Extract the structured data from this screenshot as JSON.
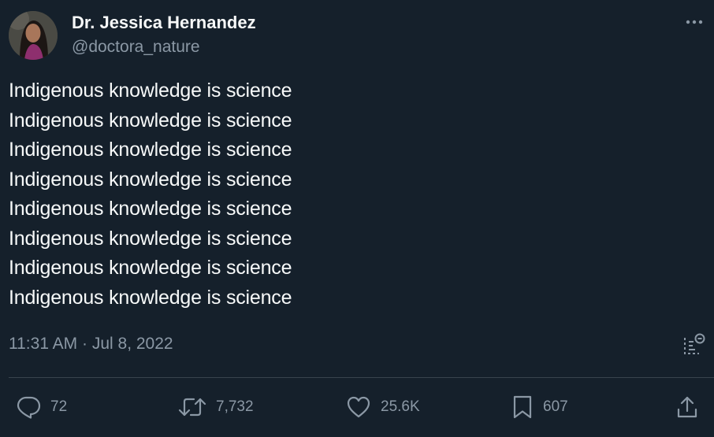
{
  "tweet": {
    "author": {
      "display_name": "Dr. Jessica Hernandez",
      "handle": "@doctora_nature"
    },
    "lines": [
      "Indigenous knowledge is science",
      "Indigenous knowledge is science",
      "Indigenous knowledge is science",
      "Indigenous knowledge is science",
      "Indigenous knowledge is science",
      "Indigenous knowledge is science",
      "Indigenous knowledge is science",
      "Indigenous knowledge is science"
    ],
    "timestamp": "11:31 AM · Jul 8, 2022"
  },
  "actions": {
    "replies": "72",
    "retweets": "7,732",
    "likes": "25.6K",
    "bookmarks": "607"
  },
  "icons": {
    "more": "more-icon",
    "analytics": "analytics-icon",
    "reply": "reply-icon",
    "retweet": "retweet-icon",
    "like": "heart-icon",
    "bookmark": "bookmark-icon",
    "share": "share-icon"
  },
  "colors": {
    "background": "#15202b",
    "text_primary": "#f7f9f9",
    "text_secondary": "#8b98a5",
    "divider": "#38444d"
  }
}
